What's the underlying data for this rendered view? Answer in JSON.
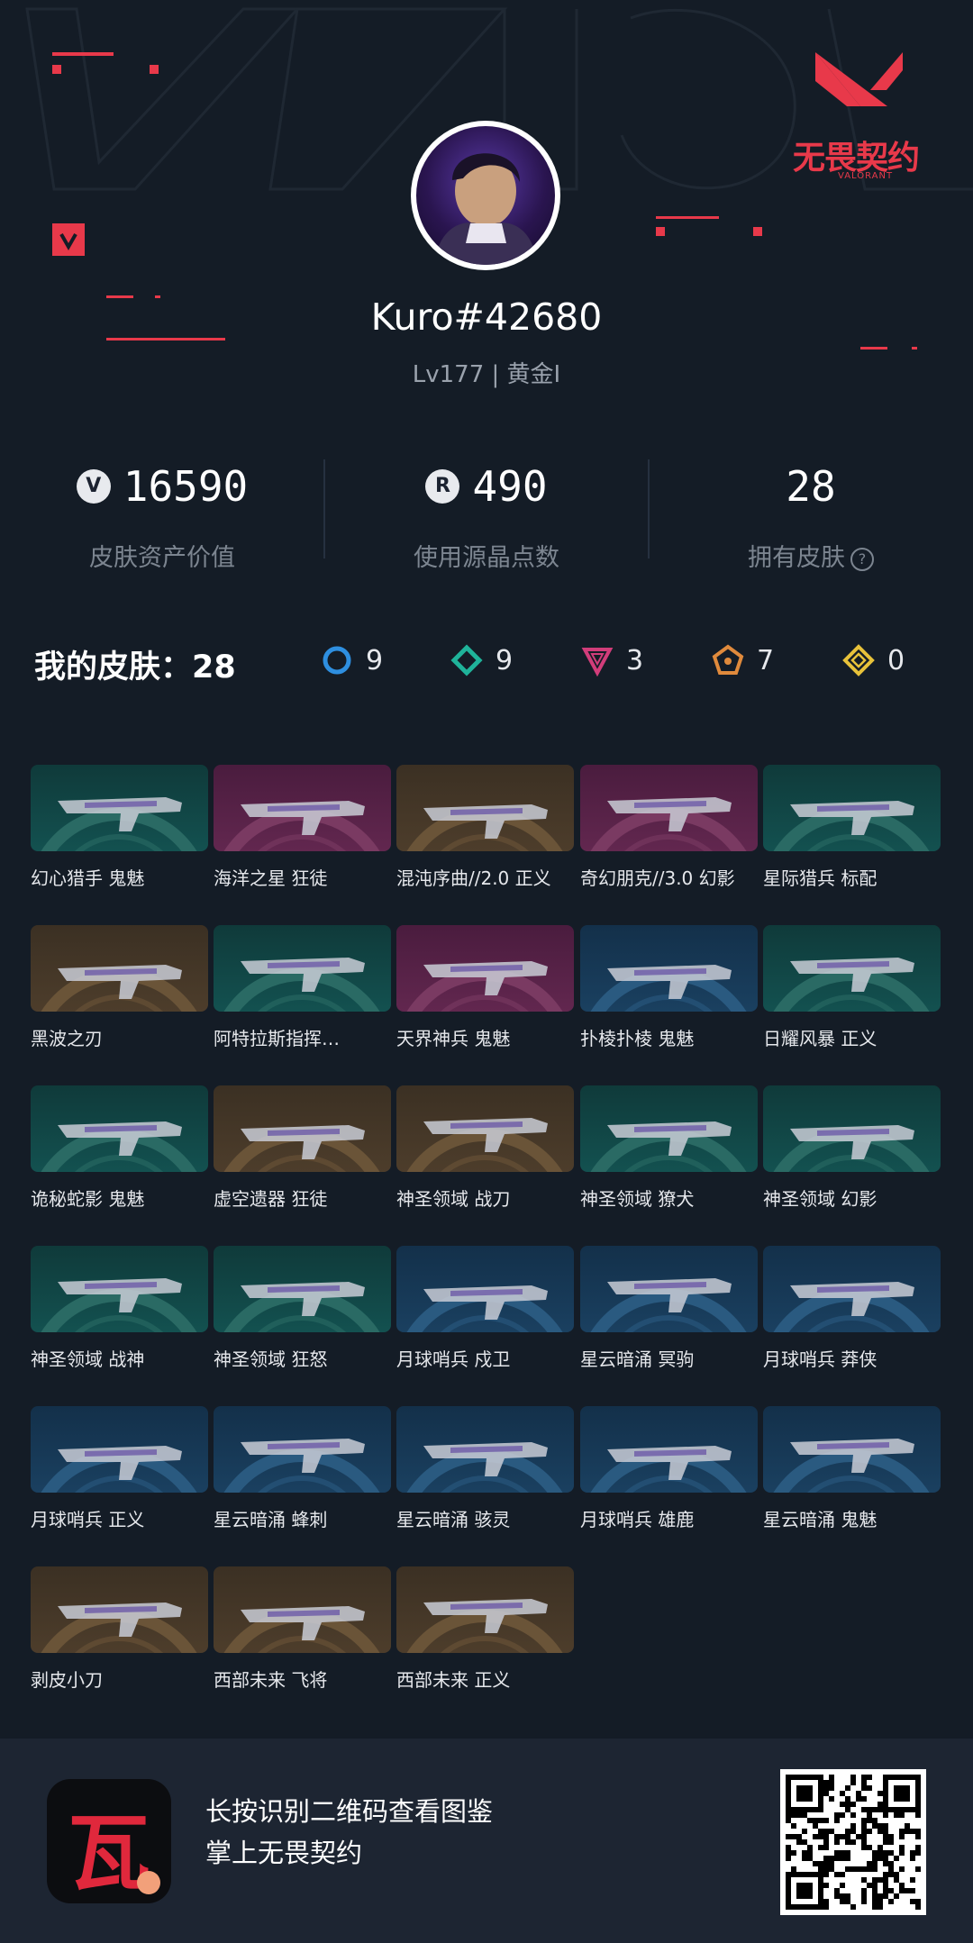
{
  "profile": {
    "username": "Kuro#42680",
    "rank": "Lv177 | 黄金I",
    "logo_text": "无畏契约",
    "logo_sub": "VALORANT"
  },
  "stats": [
    {
      "icon": "valorant-points-icon",
      "value": "16590",
      "label": "皮肤资产价值"
    },
    {
      "icon": "radianite-icon",
      "value": "490",
      "label": "使用源晶点数"
    },
    {
      "icon": "",
      "value": "28",
      "label": "拥有皮肤"
    }
  ],
  "skins_summary": {
    "label": "我的皮肤：28",
    "tiers": [
      {
        "icon": "select-tier-icon",
        "color": "#2e8fe0",
        "count": "9"
      },
      {
        "icon": "deluxe-tier-icon",
        "color": "#1fb39a",
        "count": "9"
      },
      {
        "icon": "premium-tier-icon",
        "color": "#d23d7a",
        "count": "3"
      },
      {
        "icon": "exclusive-tier-icon",
        "color": "#e08a3c",
        "count": "7"
      },
      {
        "icon": "ultra-tier-icon",
        "color": "#e8c23a",
        "count": "0"
      }
    ]
  },
  "skins": [
    {
      "name": "幻心猎手 鬼魅",
      "tier": "green"
    },
    {
      "name": "海洋之星 狂徒",
      "tier": "purple"
    },
    {
      "name": "混沌序曲//2.0 正义",
      "tier": "gold"
    },
    {
      "name": "奇幻朋克//3.0 幻影",
      "tier": "purple"
    },
    {
      "name": "星际猎兵 标配",
      "tier": "green"
    },
    {
      "name": "黑波之刃",
      "tier": "gold"
    },
    {
      "name": "阿特拉斯指挥…",
      "tier": "green"
    },
    {
      "name": "天界神兵 鬼魅",
      "tier": "purple"
    },
    {
      "name": "扑棱扑棱 鬼魅",
      "tier": "blue"
    },
    {
      "name": "日耀风暴 正义",
      "tier": "green"
    },
    {
      "name": "诡秘蛇影 鬼魅",
      "tier": "green"
    },
    {
      "name": "虚空遗器 狂徒",
      "tier": "gold"
    },
    {
      "name": "神圣领域 战刀",
      "tier": "gold"
    },
    {
      "name": "神圣领域 獠犬",
      "tier": "green"
    },
    {
      "name": "神圣领域 幻影",
      "tier": "green"
    },
    {
      "name": "神圣领域 战神",
      "tier": "green"
    },
    {
      "name": "神圣领域 狂怒",
      "tier": "green"
    },
    {
      "name": "月球哨兵 戍卫",
      "tier": "blue"
    },
    {
      "name": "星云暗涌 冥驹",
      "tier": "blue"
    },
    {
      "name": "月球哨兵 莽侠",
      "tier": "blue"
    },
    {
      "name": "月球哨兵 正义",
      "tier": "blue"
    },
    {
      "name": "星云暗涌 蜂刺",
      "tier": "blue"
    },
    {
      "name": "星云暗涌 骇灵",
      "tier": "blue"
    },
    {
      "name": "月球哨兵 雄鹿",
      "tier": "blue"
    },
    {
      "name": "星云暗涌 鬼魅",
      "tier": "blue"
    },
    {
      "name": "剥皮小刀",
      "tier": "gold"
    },
    {
      "name": "西部未来 飞将",
      "tier": "gold"
    },
    {
      "name": "西部未来 正义",
      "tier": "gold"
    }
  ],
  "footer": {
    "app_glyph": "瓦",
    "line1": "长按识别二维码查看图鉴",
    "line2": "掌上无畏契约"
  }
}
